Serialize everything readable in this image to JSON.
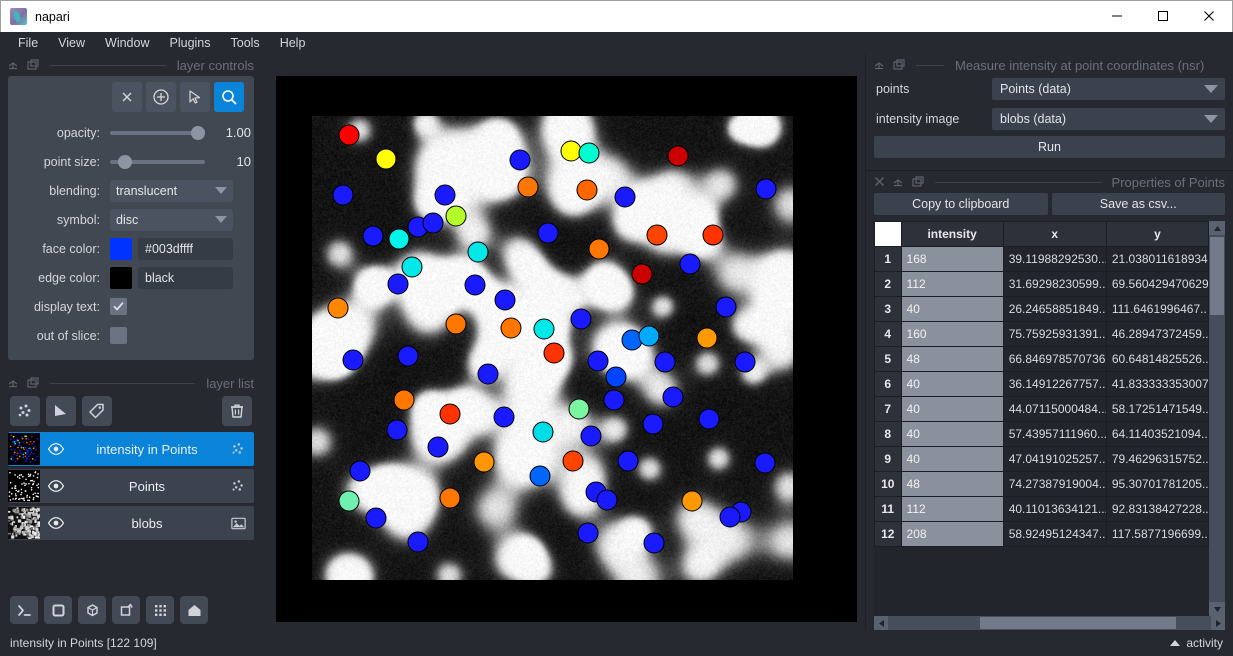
{
  "window": {
    "title": "napari",
    "app_icon": "napari-logo-icon",
    "controls": {
      "minimize": "minimize-icon",
      "maximize": "maximize-icon",
      "close": "close-icon"
    }
  },
  "menubar": {
    "items": [
      "File",
      "View",
      "Window",
      "Plugins",
      "Tools",
      "Help"
    ]
  },
  "layer_controls": {
    "dock_title": "layer controls",
    "tools": [
      {
        "name": "delete-selected-points-button",
        "icon": "x-icon",
        "active": false
      },
      {
        "name": "add-points-button",
        "icon": "plus-circle-icon",
        "active": false
      },
      {
        "name": "select-points-button",
        "icon": "cursor-arrow-icon",
        "active": false
      },
      {
        "name": "pan-zoom-button",
        "icon": "magnifier-icon",
        "active": true
      }
    ],
    "opacity": {
      "label": "opacity:",
      "value": "1.00",
      "fill": 100
    },
    "point_size": {
      "label": "point size:",
      "value": "10",
      "fill": 10
    },
    "blending": {
      "label": "blending:",
      "value": "translucent"
    },
    "symbol": {
      "label": "symbol:",
      "value": "disc"
    },
    "face_color": {
      "label": "face color:",
      "value": "#003dffff",
      "swatch": "#0033ff"
    },
    "edge_color": {
      "label": "edge color:",
      "value": "black",
      "swatch": "#000000"
    },
    "display_text": {
      "label": "display text:",
      "checked": true
    },
    "out_of_slice": {
      "label": "out of slice:",
      "checked": false
    }
  },
  "layer_list": {
    "dock_title": "layer list",
    "buttons": [
      {
        "name": "new-points-layer-button",
        "icon": "points-icon"
      },
      {
        "name": "new-shapes-layer-button",
        "icon": "shapes-icon"
      },
      {
        "name": "new-labels-layer-button",
        "icon": "labels-icon"
      },
      {
        "name": "delete-layer-button",
        "icon": "trash-icon"
      }
    ],
    "layers": [
      {
        "name": "intensity in Points",
        "type_icon": "points-icon",
        "visible": true,
        "selected": true,
        "thumb": "colored-points-thumbnail"
      },
      {
        "name": "Points",
        "type_icon": "points-icon",
        "visible": true,
        "selected": false,
        "thumb": "white-points-thumbnail"
      },
      {
        "name": "blobs",
        "type_icon": "image-icon",
        "visible": true,
        "selected": false,
        "thumb": "blobs-grayscale-thumbnail"
      }
    ]
  },
  "viewer_tools": [
    {
      "name": "console-button",
      "icon": "terminal-icon"
    },
    {
      "name": "ndisplay-toggle-button",
      "icon": "square-icon"
    },
    {
      "name": "roll-dims-button",
      "icon": "cube-icon"
    },
    {
      "name": "transpose-dims-button",
      "icon": "transpose-icon"
    },
    {
      "name": "grid-view-button",
      "icon": "grid-icon"
    },
    {
      "name": "home-reset-button",
      "icon": "home-icon"
    }
  ],
  "plugin_widget": {
    "dock_title": "Measure intensity at point coordinates (nsr)",
    "fields": [
      {
        "label": "points",
        "value": "Points (data)"
      },
      {
        "label": "intensity image",
        "value": "blobs (data)"
      }
    ],
    "run_label": "Run"
  },
  "properties_panel": {
    "dock_title": "Properties of Points",
    "copy_label": "Copy to clipboard",
    "save_label": "Save as csv...",
    "columns": [
      "intensity",
      "x",
      "y"
    ],
    "rows": [
      {
        "n": "1",
        "intensity": "168",
        "x": "39.11988292530...",
        "y": "21.038011618934"
      },
      {
        "n": "2",
        "intensity": "112",
        "x": "31.69298230599...",
        "y": "69.5604294706294"
      },
      {
        "n": "3",
        "intensity": "40",
        "x": "26.24658851849...",
        "y": "111.6461996467..."
      },
      {
        "n": "4",
        "intensity": "160",
        "x": "75.75925931391...",
        "y": "46.28947372459..."
      },
      {
        "n": "5",
        "intensity": "48",
        "x": "66.8469785707363",
        "y": "60.64814825526..."
      },
      {
        "n": "6",
        "intensity": "40",
        "x": "36.14912267757...",
        "y": "41.8333333530079"
      },
      {
        "n": "7",
        "intensity": "40",
        "x": "44.07115000484...",
        "y": "58.17251471549..."
      },
      {
        "n": "8",
        "intensity": "40",
        "x": "57.43957111960...",
        "y": "64.11403521094..."
      },
      {
        "n": "9",
        "intensity": "40",
        "x": "47.04191025257...",
        "y": "79.46296315752..."
      },
      {
        "n": "10",
        "intensity": "48",
        "x": "74.27387919004...",
        "y": "95.30701781205..."
      },
      {
        "n": "11",
        "intensity": "112",
        "x": "40.11013634121...",
        "y": "92.83138427228..."
      },
      {
        "n": "12",
        "intensity": "208",
        "x": "58.92495124347...",
        "y": "117.5877196699..."
      }
    ]
  },
  "status_bar": {
    "text": "intensity in Points [122 109]",
    "activity_label": "activity"
  },
  "canvas": {
    "points": [
      [
        7.6,
        4.2,
        "#ff0000"
      ],
      [
        15.4,
        9.2,
        "#ffff00"
      ],
      [
        43.2,
        9.4,
        "#1a1aff"
      ],
      [
        53.8,
        7.6,
        "#ffff00"
      ],
      [
        57.6,
        8.0,
        "#00ffd0"
      ],
      [
        76.0,
        8.6,
        "#cc0000"
      ],
      [
        6.4,
        17.0,
        "#1a1aff"
      ],
      [
        27.6,
        17.0,
        "#1a1aff"
      ],
      [
        30.0,
        21.6,
        "#b4ff2a"
      ],
      [
        45.0,
        15.4,
        "#ff7700"
      ],
      [
        57.2,
        16.0,
        "#ff6600"
      ],
      [
        65.0,
        17.4,
        "#1a1aff"
      ],
      [
        94.4,
        15.8,
        "#1a1aff"
      ],
      [
        22.0,
        24.0,
        "#1a1aff"
      ],
      [
        25.2,
        23.0,
        "#1a1aff"
      ],
      [
        12.6,
        25.8,
        "#1a1aff"
      ],
      [
        18.0,
        26.6,
        "#00f5ea"
      ],
      [
        49.0,
        25.2,
        "#1a1aff"
      ],
      [
        71.8,
        25.6,
        "#ff4400"
      ],
      [
        83.4,
        25.6,
        "#ff3300"
      ],
      [
        59.6,
        28.6,
        "#ff7700"
      ],
      [
        34.6,
        29.4,
        "#00e8e8"
      ],
      [
        20.8,
        32.6,
        "#00e8e8"
      ],
      [
        78.6,
        32.0,
        "#1a1aff"
      ],
      [
        17.8,
        36.2,
        "#1a1aff"
      ],
      [
        33.8,
        36.4,
        "#1a1aff"
      ],
      [
        68.6,
        34.0,
        "#cc0000"
      ],
      [
        40.2,
        39.6,
        "#1a1aff"
      ],
      [
        5.4,
        41.4,
        "#ff8800"
      ],
      [
        86.0,
        41.2,
        "#1a1aff"
      ],
      [
        30.0,
        44.8,
        "#ff7700"
      ],
      [
        56.0,
        43.8,
        "#1a1aff"
      ],
      [
        41.4,
        45.6,
        "#ff7700"
      ],
      [
        48.2,
        45.8,
        "#00e8e8"
      ],
      [
        66.6,
        48.2,
        "#0066ff"
      ],
      [
        70.0,
        47.4,
        "#00aaff"
      ],
      [
        82.2,
        47.8,
        "#ff9900"
      ],
      [
        8.6,
        52.6,
        "#1a1aff"
      ],
      [
        20.0,
        51.8,
        "#1a1aff"
      ],
      [
        50.4,
        51.0,
        "#ff3300"
      ],
      [
        59.4,
        52.8,
        "#1a1aff"
      ],
      [
        73.4,
        53.0,
        "#1a1aff"
      ],
      [
        90.0,
        53.0,
        "#1a1aff"
      ],
      [
        36.6,
        55.6,
        "#1a1aff"
      ],
      [
        63.2,
        56.2,
        "#0044ff"
      ],
      [
        19.2,
        61.2,
        "#ff7700"
      ],
      [
        62.8,
        61.2,
        "#1a1aff"
      ],
      [
        75.0,
        60.6,
        "#1a1aff"
      ],
      [
        28.6,
        64.2,
        "#ff3300"
      ],
      [
        55.6,
        63.2,
        "#7cf5a0"
      ],
      [
        40.0,
        64.8,
        "#1a1aff"
      ],
      [
        70.8,
        66.4,
        "#1a1aff"
      ],
      [
        17.6,
        67.6,
        "#1a1aff"
      ],
      [
        48.0,
        68.2,
        "#00dde8"
      ],
      [
        82.6,
        65.4,
        "#1a1aff"
      ],
      [
        26.2,
        71.4,
        "#1a1aff"
      ],
      [
        58.0,
        69.0,
        "#1a1aff"
      ],
      [
        35.8,
        74.6,
        "#ff9500"
      ],
      [
        54.2,
        74.4,
        "#ff4400"
      ],
      [
        65.8,
        74.4,
        "#1a1aff"
      ],
      [
        10.0,
        76.6,
        "#1a1aff"
      ],
      [
        94.2,
        74.8,
        "#1a1aff"
      ],
      [
        47.4,
        77.6,
        "#0066ff"
      ],
      [
        7.6,
        83.0,
        "#6ff0b0"
      ],
      [
        28.6,
        82.4,
        "#ff7700"
      ],
      [
        59.0,
        81.0,
        "#1a1aff"
      ],
      [
        61.4,
        82.8,
        "#1a1aff"
      ],
      [
        13.4,
        86.6,
        "#1a1aff"
      ],
      [
        79.0,
        83.0,
        "#ff9900"
      ],
      [
        89.2,
        85.4,
        "#1a1aff"
      ],
      [
        22.0,
        91.8,
        "#1a1aff"
      ],
      [
        57.4,
        89.8,
        "#1a1aff"
      ],
      [
        71.0,
        92.0,
        "#1a1aff"
      ],
      [
        87.0,
        86.4,
        "#1a1aff"
      ]
    ]
  }
}
